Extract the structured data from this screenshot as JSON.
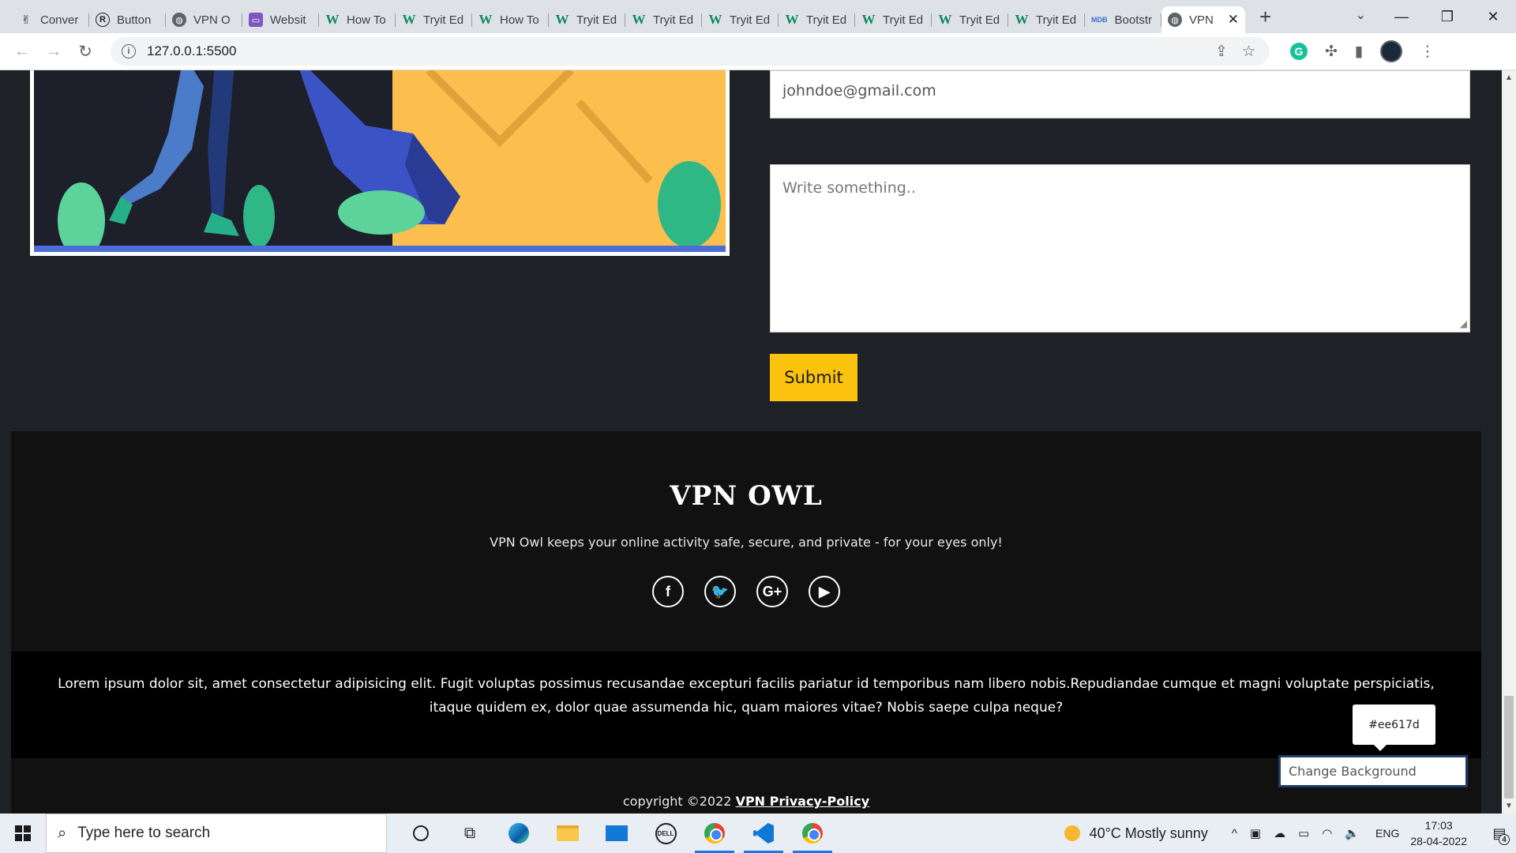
{
  "browser": {
    "tabs": [
      {
        "label": "Conver",
        "icon": "converter-icon"
      },
      {
        "label": "Button",
        "icon": "r-icon"
      },
      {
        "label": "VPN O",
        "icon": "globe-icon"
      },
      {
        "label": "Websit",
        "icon": "website-icon"
      },
      {
        "label": "How To",
        "icon": "w3-icon"
      },
      {
        "label": "Tryit Ed",
        "icon": "w3-icon"
      },
      {
        "label": "How To",
        "icon": "w3-icon"
      },
      {
        "label": "Tryit Ed",
        "icon": "w3-icon"
      },
      {
        "label": "Tryit Ed",
        "icon": "w3-icon"
      },
      {
        "label": "Tryit Ed",
        "icon": "w3-icon"
      },
      {
        "label": "Tryit Ed",
        "icon": "w3-icon"
      },
      {
        "label": "Tryit Ed",
        "icon": "w3-icon"
      },
      {
        "label": "Tryit Ed",
        "icon": "w3-icon"
      },
      {
        "label": "Tryit Ed",
        "icon": "w3-icon"
      },
      {
        "label": "Bootstr",
        "icon": "mdb-icon"
      }
    ],
    "active_tab": {
      "label": "VPN",
      "icon": "globe-icon"
    },
    "address": "127.0.0.1:5500"
  },
  "page": {
    "email_value": "johndoe@gmail.com",
    "message_placeholder": "Write something..",
    "submit_label": "Submit",
    "footer": {
      "brand": "VPN OWL",
      "tagline": "VPN Owl keeps your online activity safe, secure, and private - for your eyes only!",
      "socials": [
        {
          "name": "facebook-icon",
          "glyph": "f"
        },
        {
          "name": "twitter-icon",
          "glyph": "🐦"
        },
        {
          "name": "google-plus-icon",
          "glyph": "G+"
        },
        {
          "name": "youtube-icon",
          "glyph": "▶"
        }
      ],
      "lorem": "Lorem ipsum dolor sit, amet consectetur adipisicing elit. Fugit voluptas possimus recusandae excepturi facilis pariatur id temporibus nam libero nobis.Repudiandae cumque et magni voluptate perspiciatis, itaque quidem ex, dolor quae assumenda hic, quam maiores vitae? Nobis saepe culpa neque?",
      "copyright_prefix": "copyright ©2022",
      "copyright_link": "VPN Privacy-Policy"
    },
    "color_tooltip": "#ee617d",
    "change_bg_placeholder": "Change Background"
  },
  "taskbar": {
    "search_placeholder": "Type here to search",
    "weather": "40°C  Mostly sunny",
    "lang": "ENG",
    "time": "17:03",
    "date": "28-04-2022",
    "notifications": "4"
  },
  "colors": {
    "accent_yellow": "#fbc30e",
    "page_bg": "#1e2227",
    "footer_bg": "#111111"
  }
}
